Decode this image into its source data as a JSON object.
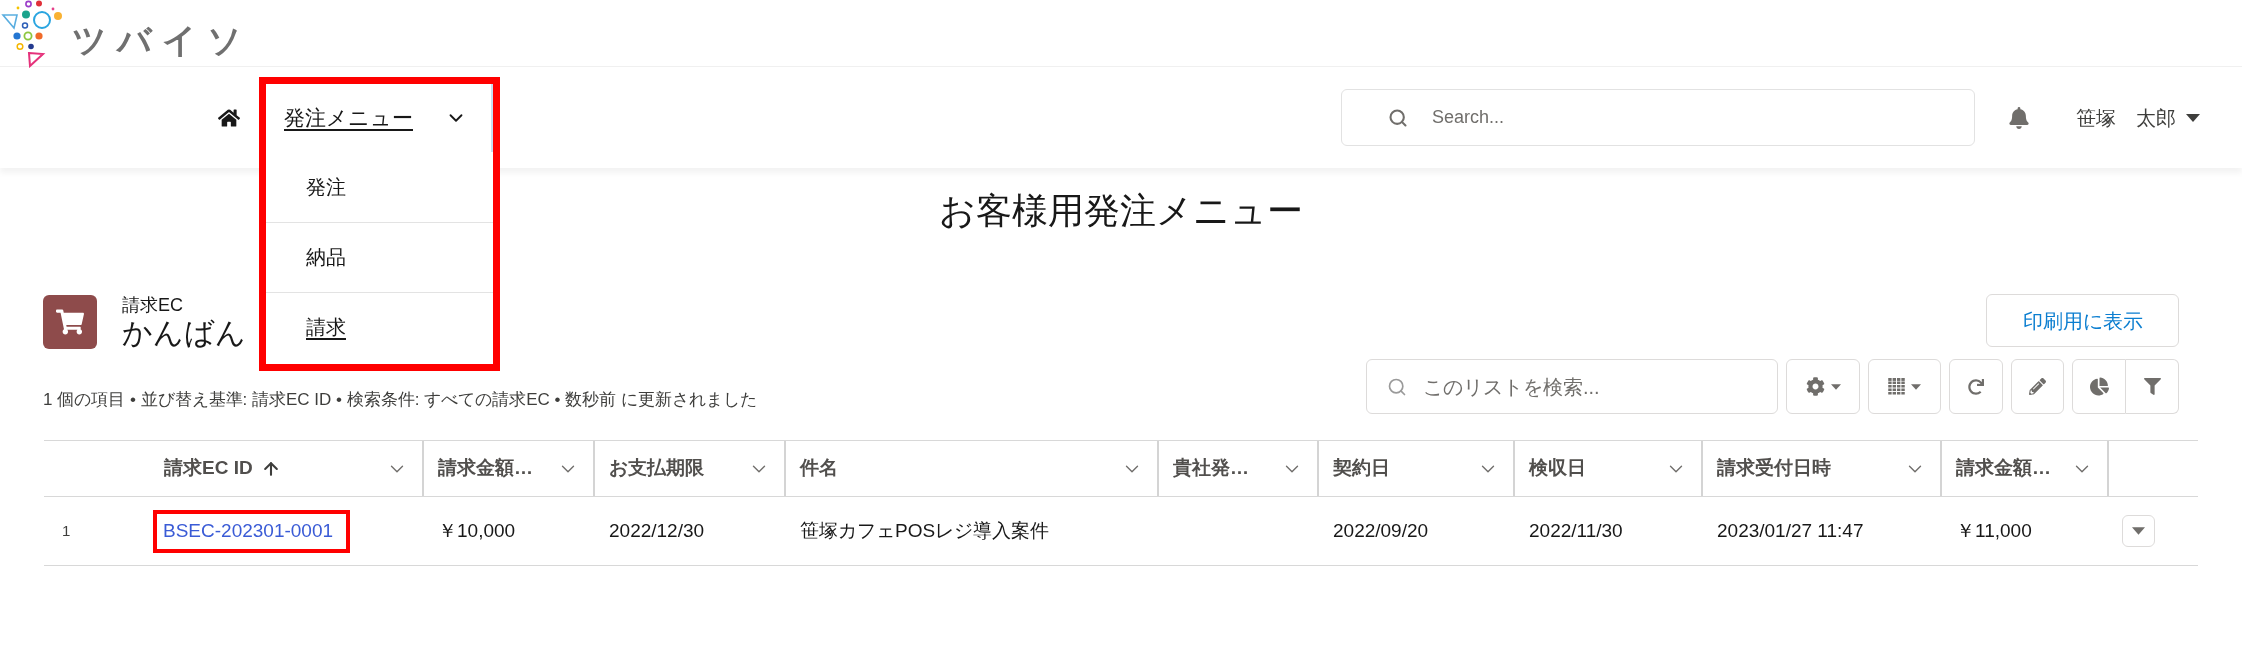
{
  "logo": {
    "text": "ツバイソ"
  },
  "nav": {
    "label": "発注メニュー",
    "expanded": true,
    "highlighted": true,
    "items": [
      {
        "label": "発注",
        "hovered": false
      },
      {
        "label": "納品",
        "hovered": false
      },
      {
        "label": "請求",
        "hovered": true
      }
    ]
  },
  "global_search": {
    "placeholder": "Search..."
  },
  "user": {
    "name": "笹塚　太郎"
  },
  "page_title": "お客様用発注メニュー",
  "list_header": {
    "object_label": "請求EC",
    "view_name": "かんばん",
    "print_button": "印刷用に表示"
  },
  "list_search": {
    "placeholder": "このリストを検索..."
  },
  "summary": "1 個の項目 • 並び替え基準: 請求EC ID • 検索条件: すべての請求EC • 数秒前 に更新されました",
  "table": {
    "columns": [
      {
        "label": "請求EC ID",
        "sorted": true
      },
      {
        "label": "請求金額…",
        "sorted": false
      },
      {
        "label": "お支払期限",
        "sorted": false
      },
      {
        "label": "件名",
        "sorted": false
      },
      {
        "label": "貴社発…",
        "sorted": false
      },
      {
        "label": "契約日",
        "sorted": false
      },
      {
        "label": "検収日",
        "sorted": false
      },
      {
        "label": "請求受付日時",
        "sorted": false
      },
      {
        "label": "請求金額…",
        "sorted": false
      }
    ],
    "rows": [
      {
        "number": "1",
        "highlighted": true,
        "cells": [
          {
            "kind": "link",
            "text": "BSEC-202301-0001"
          },
          {
            "kind": "text",
            "text": "￥10,000"
          },
          {
            "kind": "text",
            "text": "2022/12/30"
          },
          {
            "kind": "text",
            "text": "笹塚カフェPOSレジ導入案件"
          },
          null,
          {
            "kind": "text",
            "text": "2022/09/20"
          },
          {
            "kind": "text",
            "text": "2022/11/30"
          },
          {
            "kind": "text",
            "text": "2023/01/27 11:47"
          },
          {
            "kind": "text",
            "text": "￥11,000"
          }
        ]
      }
    ]
  }
}
